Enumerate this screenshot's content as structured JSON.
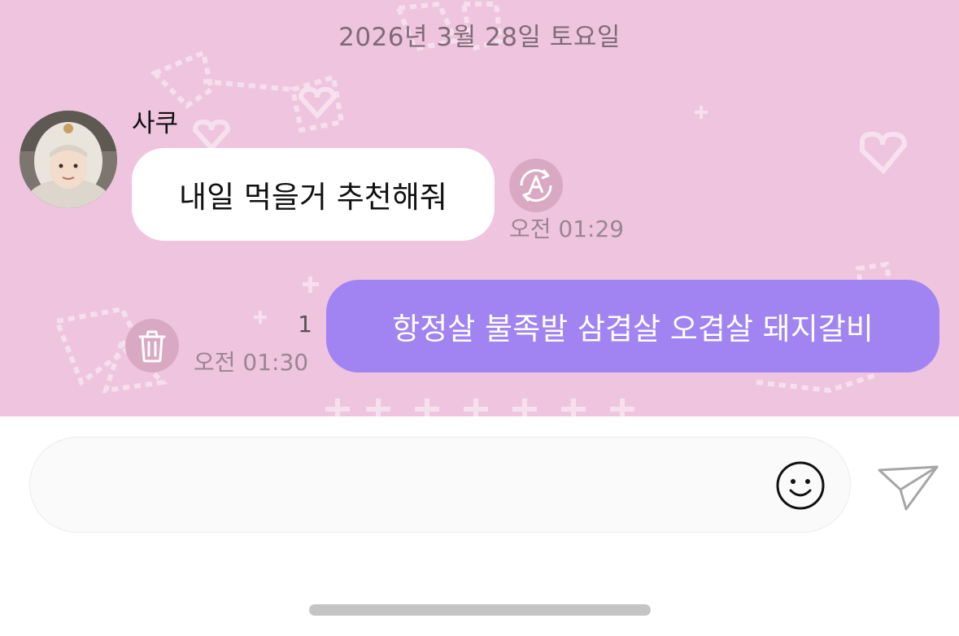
{
  "chat": {
    "date_divider": "2026년 3월 28일 토요일",
    "incoming": {
      "sender": "사쿠",
      "text": "내일 먹을거 추천해줘",
      "time": "오전 01:29"
    },
    "outgoing": {
      "text": "항정살 불족발 삼겹살 오겹살 돼지갈비",
      "time": "오전 01:30",
      "unread_count": "1"
    }
  },
  "composer": {
    "placeholder": "",
    "value": ""
  },
  "colors": {
    "chat_background": "#efc4df",
    "incoming_bubble": "#ffffff",
    "outgoing_bubble": "#a184f1",
    "action_circle": "#d9a9c4"
  },
  "icons": {
    "translate": "translate-icon",
    "delete": "trash-icon",
    "emoji": "smiley-icon",
    "send": "paper-plane-icon"
  }
}
